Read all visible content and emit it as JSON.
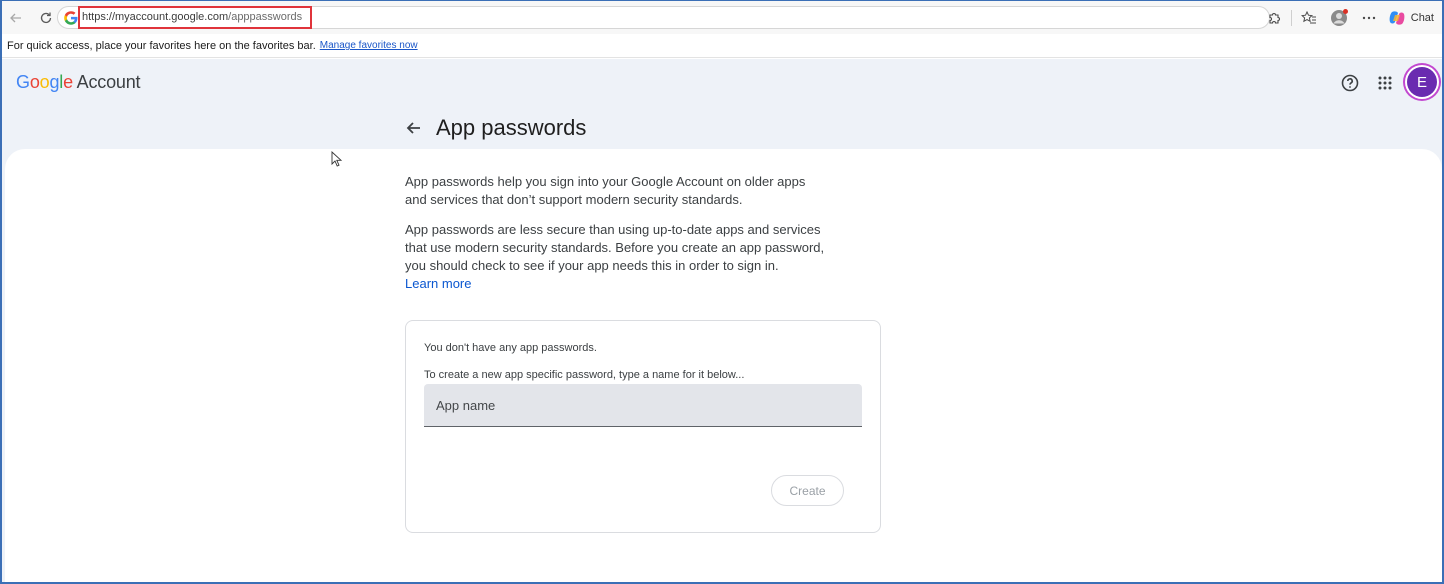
{
  "browser": {
    "url_host": "https://myaccount.google.com",
    "url_path": "/apppasswords",
    "chat_label": "Chat"
  },
  "favorites_bar": {
    "message": "For quick access, place your favorites here on the favorites bar.",
    "link_label": "Manage favorites now"
  },
  "header": {
    "brand_letters": [
      "G",
      "o",
      "o",
      "g",
      "l",
      "e"
    ],
    "brand_suffix": " Account",
    "avatar_initial": "E"
  },
  "page": {
    "title": "App passwords",
    "description_1": "App passwords help you sign into your Google Account on older apps and services that don’t support modern security standards.",
    "description_2": "App passwords are less secure than using up-to-date apps and services that use modern security standards. Before you create an app password, you should check to see if your app needs this in order to sign in.",
    "learn_more": "Learn more"
  },
  "app_passwords": {
    "empty_message": "You don't have any app passwords.",
    "create_hint": "To create a new app specific password, type a name for it below...",
    "input_placeholder": "App name",
    "input_value": "",
    "create_label": "Create"
  },
  "colors": {
    "page_bg": "#eef2f8",
    "link": "#0b57d0",
    "highlight": "#e0343b",
    "avatar": "#6a2bb0"
  },
  "icons": [
    "back-arrow-icon",
    "refresh-icon",
    "google-g-icon",
    "extensions-icon",
    "favorites-icon",
    "profile-icon",
    "more-icon",
    "copilot-icon",
    "help-icon",
    "apps-grid-icon",
    "arrow-left-icon",
    "cursor-icon"
  ]
}
